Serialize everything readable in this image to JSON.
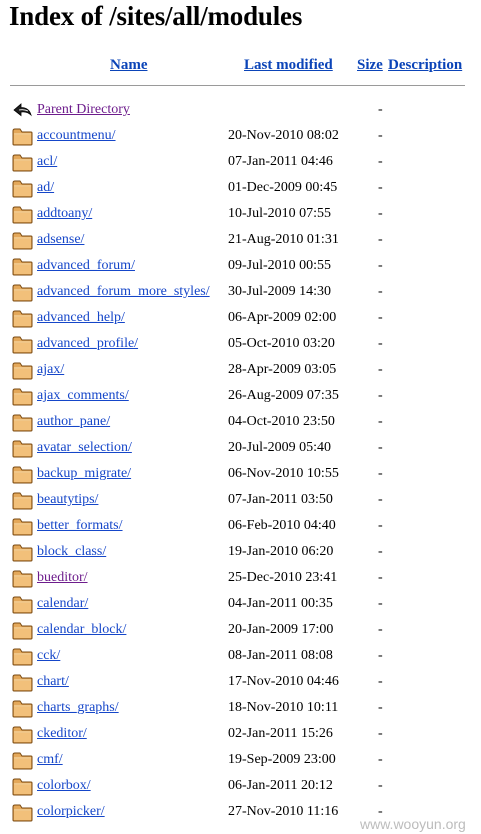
{
  "page": {
    "title": "Index of /sites/all/modules"
  },
  "columns": {
    "name": "Name",
    "last_modified": "Last modified",
    "size": "Size",
    "description": "Description"
  },
  "entries": [
    {
      "name": "Parent Directory",
      "date": "",
      "size": "-",
      "icon": "back-icon",
      "visited": true
    },
    {
      "name": "accountmenu/",
      "date": "20-Nov-2010 08:02",
      "size": "-",
      "icon": "folder-icon",
      "visited": false
    },
    {
      "name": "acl/",
      "date": "07-Jan-2011 04:46",
      "size": "-",
      "icon": "folder-icon",
      "visited": false
    },
    {
      "name": "ad/",
      "date": "01-Dec-2009 00:45",
      "size": "-",
      "icon": "folder-icon",
      "visited": false
    },
    {
      "name": "addtoany/",
      "date": "10-Jul-2010 07:55",
      "size": "-",
      "icon": "folder-icon",
      "visited": false
    },
    {
      "name": "adsense/",
      "date": "21-Aug-2010 01:31",
      "size": "-",
      "icon": "folder-icon",
      "visited": false
    },
    {
      "name": "advanced_forum/",
      "date": "09-Jul-2010 00:55",
      "size": "-",
      "icon": "folder-icon",
      "visited": false
    },
    {
      "name": "advanced_forum_more_styles/",
      "date": "30-Jul-2009 14:30",
      "size": "-",
      "icon": "folder-icon",
      "visited": false
    },
    {
      "name": "advanced_help/",
      "date": "06-Apr-2009 02:00",
      "size": "-",
      "icon": "folder-icon",
      "visited": false
    },
    {
      "name": "advanced_profile/",
      "date": "05-Oct-2010 03:20",
      "size": "-",
      "icon": "folder-icon",
      "visited": false
    },
    {
      "name": "ajax/",
      "date": "28-Apr-2009 03:05",
      "size": "-",
      "icon": "folder-icon",
      "visited": false
    },
    {
      "name": "ajax_comments/",
      "date": "26-Aug-2009 07:35",
      "size": "-",
      "icon": "folder-icon",
      "visited": false
    },
    {
      "name": "author_pane/",
      "date": "04-Oct-2010 23:50",
      "size": "-",
      "icon": "folder-icon",
      "visited": false
    },
    {
      "name": "avatar_selection/",
      "date": "20-Jul-2009 05:40",
      "size": "-",
      "icon": "folder-icon",
      "visited": false
    },
    {
      "name": "backup_migrate/",
      "date": "06-Nov-2010 10:55",
      "size": "-",
      "icon": "folder-icon",
      "visited": false
    },
    {
      "name": "beautytips/",
      "date": "07-Jan-2011 03:50",
      "size": "-",
      "icon": "folder-icon",
      "visited": false
    },
    {
      "name": "better_formats/",
      "date": "06-Feb-2010 04:40",
      "size": "-",
      "icon": "folder-icon",
      "visited": false
    },
    {
      "name": "block_class/",
      "date": "19-Jan-2010 06:20",
      "size": "-",
      "icon": "folder-icon",
      "visited": false
    },
    {
      "name": "bueditor/",
      "date": "25-Dec-2010 23:41",
      "size": "-",
      "icon": "folder-icon",
      "visited": true
    },
    {
      "name": "calendar/",
      "date": "04-Jan-2011 00:35",
      "size": "-",
      "icon": "folder-icon",
      "visited": false
    },
    {
      "name": "calendar_block/",
      "date": "20-Jan-2009 17:00",
      "size": "-",
      "icon": "folder-icon",
      "visited": false
    },
    {
      "name": "cck/",
      "date": "08-Jan-2011 08:08",
      "size": "-",
      "icon": "folder-icon",
      "visited": false
    },
    {
      "name": "chart/",
      "date": "17-Nov-2010 04:46",
      "size": "-",
      "icon": "folder-icon",
      "visited": false
    },
    {
      "name": "charts_graphs/",
      "date": "18-Nov-2010 10:11",
      "size": "-",
      "icon": "folder-icon",
      "visited": false
    },
    {
      "name": "ckeditor/",
      "date": "02-Jan-2011 15:26",
      "size": "-",
      "icon": "folder-icon",
      "visited": false
    },
    {
      "name": "cmf/",
      "date": "19-Sep-2009 23:00",
      "size": "-",
      "icon": "folder-icon",
      "visited": false
    },
    {
      "name": "colorbox/",
      "date": "06-Jan-2011 20:12",
      "size": "-",
      "icon": "folder-icon",
      "visited": false
    },
    {
      "name": "colorpicker/",
      "date": "27-Nov-2010 11:16",
      "size": "-",
      "icon": "folder-icon",
      "visited": false
    }
  ],
  "watermark": "www.wooyun.org",
  "colors": {
    "link": "#1546c9",
    "visited": "#6d1c8c",
    "folder": "#e4a85a"
  }
}
